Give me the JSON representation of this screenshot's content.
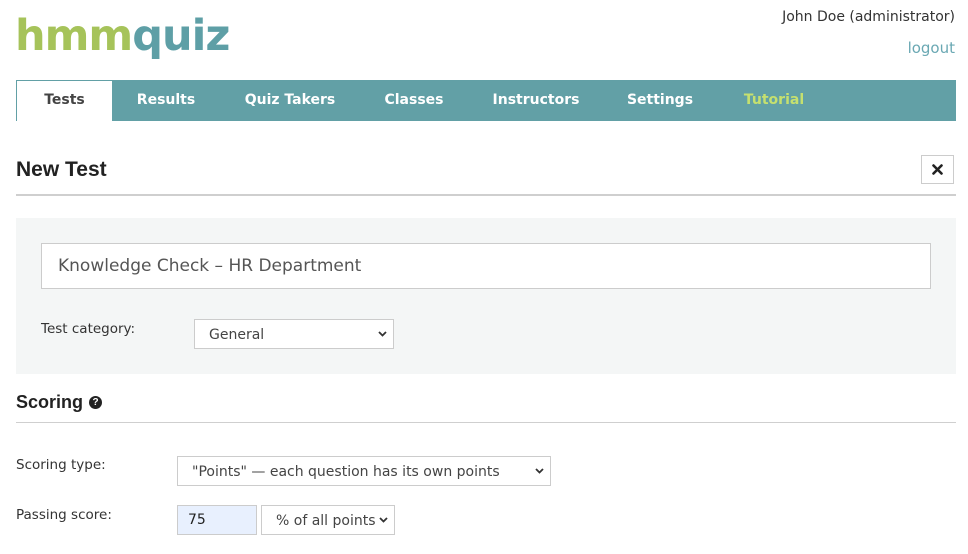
{
  "logo": {
    "part1": "hmm",
    "part2": "quiz"
  },
  "header": {
    "user": "John Doe (administrator)",
    "logout_label": "logout"
  },
  "nav": {
    "tabs": [
      {
        "label": "Tests",
        "active": true
      },
      {
        "label": "Results"
      },
      {
        "label": "Quiz Takers"
      },
      {
        "label": "Classes"
      },
      {
        "label": "Instructors"
      },
      {
        "label": "Settings"
      },
      {
        "label": "Tutorial"
      }
    ]
  },
  "page": {
    "title": "New Test",
    "close_icon": "close-icon"
  },
  "test_form": {
    "title_value": "Knowledge Check – HR Department",
    "category_label": "Test category:",
    "category_value": "General"
  },
  "scoring": {
    "title": "Scoring",
    "help_icon": "question-circle-icon",
    "type_label": "Scoring type:",
    "type_value": "\"Points\" — each question has its own points",
    "passing_label": "Passing score:",
    "passing_value": "75",
    "passing_unit": "% of all points"
  },
  "colors": {
    "nav_bg": "#62a0a6",
    "logo_green": "#a6c35a",
    "logo_teal": "#5e9fa6",
    "tutorial": "#c5e06f",
    "link": "#6aa8b3"
  }
}
